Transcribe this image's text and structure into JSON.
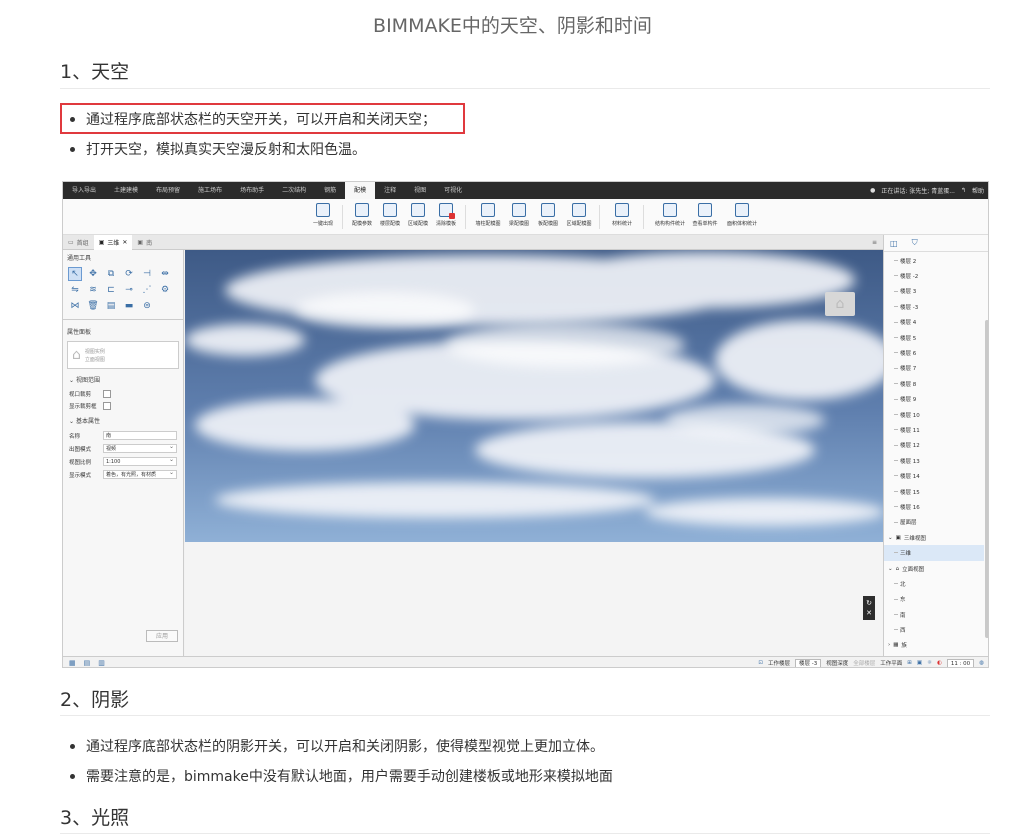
{
  "title": "BIMMAKE中的天空、阴影和时间",
  "sections": [
    {
      "heading": "1、天空",
      "bullets": [
        "通过程序底部状态栏的天空开关，可以开启和关闭天空；",
        "打开天空，模拟真实天空漫反射和太阳色温。"
      ]
    },
    {
      "heading": "2、阴影",
      "bullets": [
        "通过程序底部状态栏的阴影开关，可以开启和关闭阴影，使得模型视觉上更加立体。",
        "需要注意的是，bimmake中没有默认地面，用户需要手动创建楼板或地形来模拟地面"
      ]
    },
    {
      "heading": "3、光照",
      "bullets": []
    }
  ],
  "app": {
    "menu": [
      "导入导出",
      "土建建模",
      "布局预留",
      "施工场布",
      "场布助手",
      "二次结构",
      "钢筋",
      "配模",
      "注释",
      "视图",
      "可视化"
    ],
    "menu_active_index": 7,
    "menu_right": {
      "user": "正在讲话: 张先生; 青蓝蛋...",
      "help": "帮助"
    },
    "ribbon": [
      {
        "label": "一键出现",
        "red": false
      },
      {
        "label": "配模参数",
        "red": false
      },
      {
        "label": "楼层配模",
        "red": false
      },
      {
        "label": "区域配模",
        "red": false
      },
      {
        "label": "清除模板",
        "red": true
      },
      {
        "label": "墙柱配模图",
        "red": false
      },
      {
        "label": "梁配模图",
        "red": false
      },
      {
        "label": "板配模图",
        "red": false
      },
      {
        "label": "区域配模图",
        "red": false
      },
      {
        "label": "材料统计",
        "red": false
      },
      {
        "label": "结构构件统计",
        "red": false
      },
      {
        "label": "查看单构件",
        "red": false
      },
      {
        "label": "面积体积统计",
        "red": false
      }
    ],
    "tabs": [
      {
        "label": "首组"
      },
      {
        "label": "三维"
      },
      {
        "label": "南"
      }
    ],
    "left_panel": {
      "tools_title": "通用工具",
      "props_title": "属性面板",
      "card_line1": "视图实例",
      "card_line2": "立面视图",
      "section_view_range": "视图范围",
      "clip_label": "视口裁剪",
      "show_clip_label": "显示裁剪框",
      "section_basic": "基本属性",
      "name_label": "名称",
      "name_value": "南",
      "mode_label": "出图模式",
      "mode_value": "视频",
      "scale_label": "视图比例",
      "scale_value": "1:100",
      "display_label": "显示模式",
      "display_value": "着色，有光照，有材质",
      "apply": "应用"
    },
    "tree": {
      "floors": [
        "楼层 2",
        "楼层 -2",
        "楼层 3",
        "楼层 -3",
        "楼层 4",
        "楼层 5",
        "楼层 6",
        "楼层 7",
        "楼层 8",
        "楼层 9",
        "楼层 10",
        "楼层 11",
        "楼层 12",
        "楼层 13",
        "楼层 14",
        "楼层 15",
        "楼层 16",
        "屋面层"
      ],
      "group_3d": "三维视图",
      "item_3d": "三维",
      "group_elev": "立面视图",
      "elevations": [
        "北",
        "东",
        "南",
        "西"
      ],
      "group_other": "族"
    },
    "status": {
      "work_floor_label": "工作楼层",
      "work_floor_value": "楼层 -3",
      "view_depth_label": "视图深度",
      "view_depth_value": "全部楼层",
      "work_plane_label": "工作平面",
      "time_value": "11 : 00"
    }
  },
  "colors": {
    "highlight_border": "#e0393e",
    "menu_bg": "#2b2b2b",
    "sky_top": "#3e5a86",
    "sky_bottom": "#8fb0d6"
  }
}
